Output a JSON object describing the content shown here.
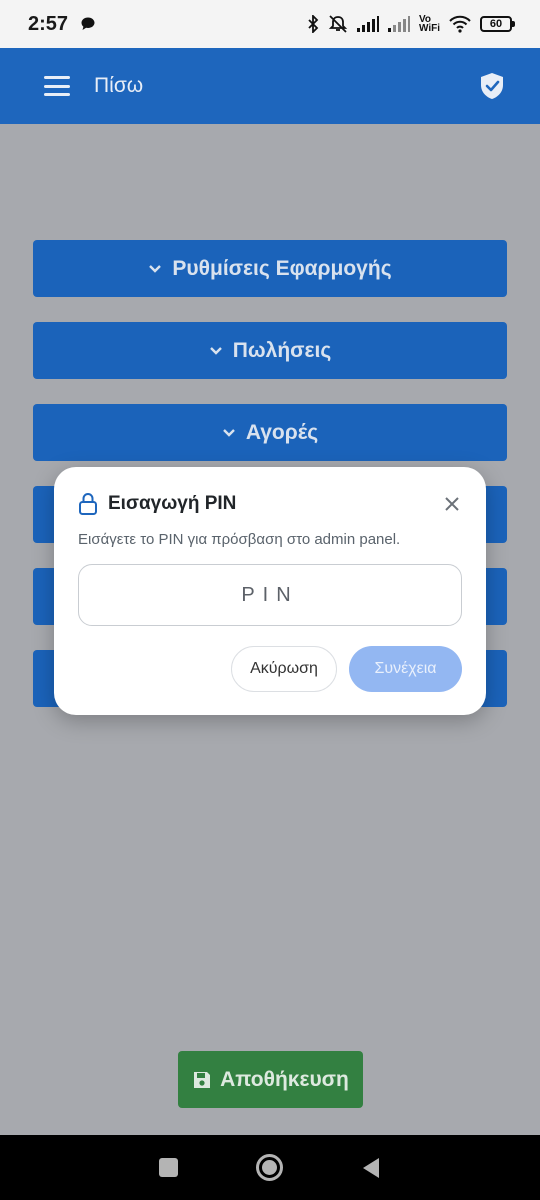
{
  "status_bar": {
    "time": "2:57",
    "vowifi_line1": "Vo",
    "vowifi_line2": "WiFi",
    "battery": "60",
    "icons": [
      "chat-bubble-icon",
      "bluetooth-icon",
      "mute-icon",
      "signal-icon",
      "signal-icon",
      "wifi-icon",
      "battery-icon"
    ]
  },
  "app_bar": {
    "title": "Πίσω",
    "icons": [
      "menu-icon",
      "shield-check-icon"
    ],
    "color": "#1e66bd"
  },
  "menu": {
    "items": [
      {
        "label": "Ρυθμίσεις Εφαρμογής"
      },
      {
        "label": "Πωλήσεις"
      },
      {
        "label": "Αγορές"
      }
    ]
  },
  "save_button": {
    "label": "Αποθήκευση",
    "icon": "floppy-disk-icon",
    "color": "#338041"
  },
  "dialog": {
    "title": "Εισαγωγή PIN",
    "subtitle": "Εισάγετε το PIN για πρόσβαση στο admin panel.",
    "pin_placeholder": "PIN",
    "pin_value": "",
    "cancel_label": "Ακύρωση",
    "continue_label": "Συνέχεια",
    "icons": [
      "lock-icon",
      "close-icon"
    ]
  },
  "nav_bar": {
    "icons": [
      "recents-icon",
      "home-icon",
      "back-icon"
    ]
  }
}
